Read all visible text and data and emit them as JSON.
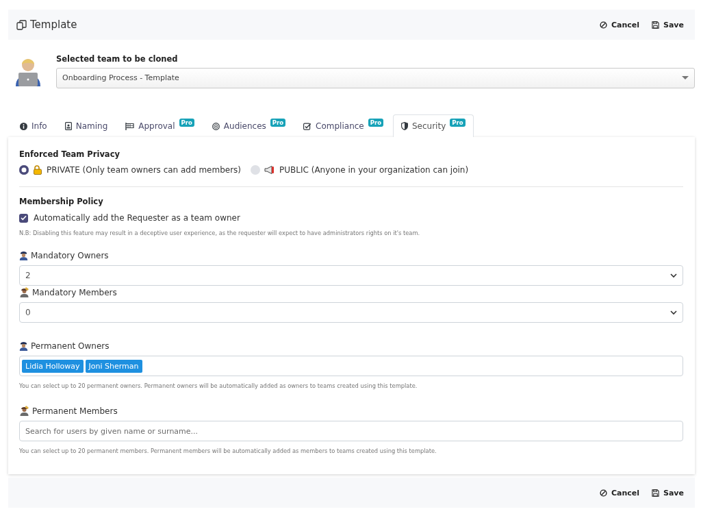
{
  "header": {
    "title": "Template",
    "actions": [
      {
        "kind": "cancel",
        "label": "Cancel"
      },
      {
        "kind": "save",
        "label": "Save"
      }
    ]
  },
  "team": {
    "label": "Selected team to be cloned",
    "value": "Onboarding Process - Template"
  },
  "tabs": [
    {
      "label": "Info",
      "selected": false
    },
    {
      "label": "Naming",
      "selected": false
    },
    {
      "label": "Approval",
      "badge": "Pro",
      "selected": false
    },
    {
      "label": "Audiences",
      "badge": "Pro",
      "selected": false
    },
    {
      "label": "Compliance",
      "badge": "Pro",
      "selected": false
    },
    {
      "label": "Security",
      "badge": "Pro",
      "selected": true
    }
  ],
  "privacy": {
    "title": "Enforced Team Privacy",
    "options": [
      {
        "label": "PRIVATE (Only team owners can add members)",
        "selected": true
      },
      {
        "label": "PUBLIC (Anyone in your organization can join)",
        "selected": false
      }
    ]
  },
  "membership": {
    "title": "Membership Policy",
    "checkbox": {
      "label": "Automatically add the Requester as a team owner",
      "checked": true
    },
    "note": "N.B: Disabling this feature may result in a deceptive user experience, as the requester will expect to have administrators rights on it's team."
  },
  "fields": [
    {
      "kind": "select",
      "label": "Mandatory Owners",
      "value": "2"
    },
    {
      "kind": "select",
      "label": "Mandatory Members",
      "value": "0"
    },
    {
      "kind": "tags",
      "label": "Permanent Owners",
      "tags": [
        "Lidia Holloway",
        "Joni Sherman"
      ],
      "help": "You can select up to 20 permanent owners. Permanent owners will be automatically added as owners to teams created using this template."
    },
    {
      "kind": "search",
      "label": "Permanent Members",
      "placeholder": "Search for users by given name or surname...",
      "help": "You can select up to 20 permanent members. Permanent members will be automatically added as members to teams created using this template."
    }
  ],
  "footer": {
    "actions": [
      {
        "kind": "cancel",
        "label": "Cancel"
      },
      {
        "kind": "save",
        "label": "Save"
      }
    ]
  }
}
